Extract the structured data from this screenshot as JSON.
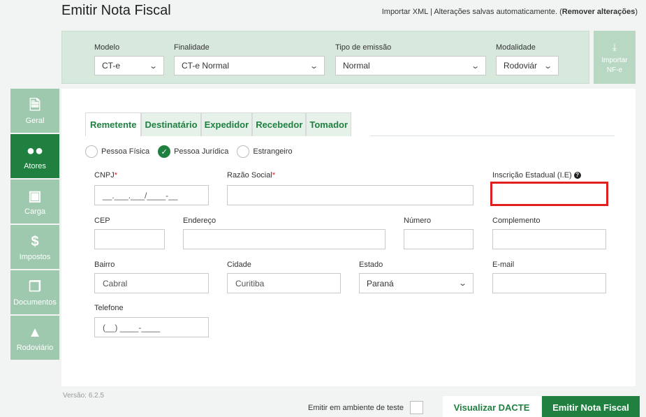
{
  "page": {
    "title": "Emitir Nota Fiscal",
    "import_xml": "Importar XML",
    "separator": " | ",
    "autosave": "Alterações salvas automaticamente.",
    "remove_prefix": " (",
    "remove_changes": "Remover alterações",
    "remove_suffix": ")"
  },
  "header": {
    "modelo": {
      "label": "Modelo",
      "value": "CT-e"
    },
    "finalidade": {
      "label": "Finalidade",
      "value": "CT-e Normal"
    },
    "tipo_emissao": {
      "label": "Tipo de emissão",
      "value": "Normal"
    },
    "modalidade": {
      "label": "Modalidade",
      "value": "Rodoviár"
    },
    "import_nfe": {
      "line1": "Importar",
      "line2": "NF-e",
      "icon": "download-icon"
    }
  },
  "sidebar": {
    "items": [
      {
        "label": "Geral",
        "icon": "document-icon"
      },
      {
        "label": "Atores",
        "icon": "users-icon"
      },
      {
        "label": "Carga",
        "icon": "cart-icon"
      },
      {
        "label": "Impostos",
        "icon": "dollar-icon"
      },
      {
        "label": "Documentos",
        "icon": "documents-icon"
      },
      {
        "label": "Rodoviário",
        "icon": "road-icon"
      }
    ]
  },
  "tabs": [
    "Remetente",
    "Destinatário",
    "Expedidor",
    "Recebedor",
    "Tomador"
  ],
  "person_type": {
    "options": [
      "Pessoa Física",
      "Pessoa Jurídica",
      "Estrangeiro"
    ],
    "selected": "Pessoa Jurídica"
  },
  "form": {
    "cnpj": {
      "label": "CNPJ",
      "required": "*",
      "value": "__.___.___/____-__"
    },
    "razao_social": {
      "label": "Razão Social",
      "required": "*",
      "value": ""
    },
    "ie": {
      "label": "Inscrição Estadual (I.E)",
      "help": "?",
      "value": ""
    },
    "cep": {
      "label": "CEP",
      "value": ""
    },
    "endereco": {
      "label": "Endereço",
      "value": ""
    },
    "numero": {
      "label": "Número",
      "value": ""
    },
    "complemento": {
      "label": "Complemento",
      "value": ""
    },
    "bairro": {
      "label": "Bairro",
      "value": "Cabral"
    },
    "cidade": {
      "label": "Cidade",
      "value": "Curitiba"
    },
    "estado": {
      "label": "Estado",
      "value": "Paraná"
    },
    "email": {
      "label": "E-mail",
      "value": ""
    },
    "telefone": {
      "label": "Telefone",
      "value": "(__) ____-____"
    }
  },
  "footer": {
    "version": "Versão: 6.2.5",
    "test_env": "Emitir em ambiente de teste",
    "preview_button": "Visualizar DACTE",
    "emit_button": "Emitir Nota Fiscal"
  },
  "colors": {
    "primary": "#1f8040",
    "sidebar_inactive": "#9fc9ae",
    "header_bg": "#d7e8dd",
    "highlight": "#e02020"
  }
}
